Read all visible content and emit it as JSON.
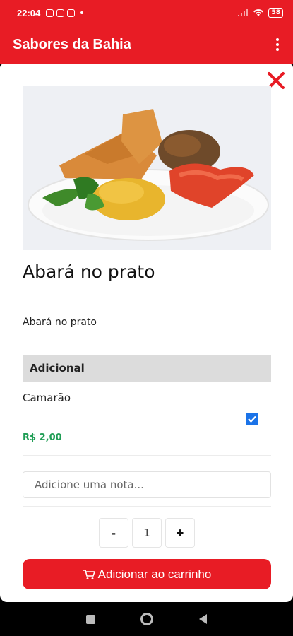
{
  "status_bar": {
    "time": "22:04",
    "battery": "58"
  },
  "app_bar": {
    "title": "Sabores da Bahia"
  },
  "product": {
    "title": "Abará no prato",
    "description": "Abará no prato"
  },
  "addons": {
    "header": "Adicional",
    "items": [
      {
        "name": "Camarão",
        "price": "R$ 2,00",
        "checked": true
      }
    ]
  },
  "note": {
    "placeholder": "Adicione uma nota..."
  },
  "quantity": {
    "minus": "-",
    "value": "1",
    "plus": "+"
  },
  "cart": {
    "label": "Adicionar ao carrinho"
  },
  "colors": {
    "brand": "#e81c25",
    "price": "#1f9d55",
    "checkbox": "#1a73e8"
  }
}
